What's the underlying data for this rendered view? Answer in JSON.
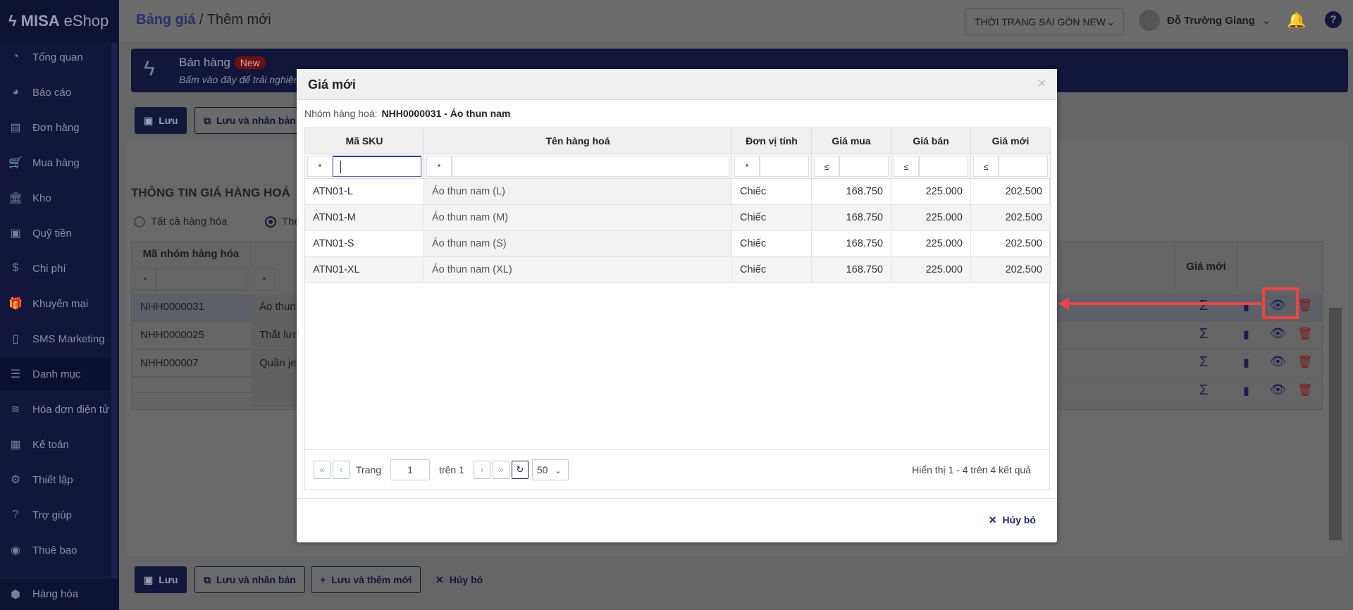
{
  "app": {
    "logo": "MISA",
    "logo_suffix": "eShop"
  },
  "sidebar": {
    "items": [
      {
        "label": "Tổng quan",
        "icon": "dashboard-icon",
        "glyph": "◔"
      },
      {
        "label": "Báo cáo",
        "icon": "pie-chart-icon",
        "glyph": "◕"
      },
      {
        "label": "Đơn hàng",
        "icon": "order-icon",
        "glyph": "▤"
      },
      {
        "label": "Mua hàng",
        "icon": "cart-icon",
        "glyph": "🛒"
      },
      {
        "label": "Kho",
        "icon": "warehouse-icon",
        "glyph": "🏛"
      },
      {
        "label": "Quỹ tiền",
        "icon": "safe-icon",
        "glyph": "▣"
      },
      {
        "label": "Chi phí",
        "icon": "money-bag-icon",
        "glyph": "$"
      },
      {
        "label": "Khuyến mại",
        "icon": "gift-icon",
        "glyph": "🎁"
      },
      {
        "label": "SMS Marketing",
        "icon": "phone-icon",
        "glyph": "▯"
      },
      {
        "label": "Danh mục",
        "icon": "list-icon",
        "glyph": "☰"
      },
      {
        "label": "Hóa đơn điện tử",
        "icon": "invoice-icon",
        "glyph": "≋"
      },
      {
        "label": "Kế toán",
        "icon": "calculator-icon",
        "glyph": "▦"
      },
      {
        "label": "Thiết lập",
        "icon": "gear-icon",
        "glyph": "⚙"
      },
      {
        "label": "Trợ giúp",
        "icon": "help-icon",
        "glyph": "?"
      },
      {
        "label": "Thuê bao",
        "icon": "user-circle-icon",
        "glyph": "◉"
      }
    ],
    "bottom": {
      "label": "Hàng hóa",
      "glyph": "⬢"
    }
  },
  "header": {
    "breadcrumb_parent": "Bảng giá",
    "breadcrumb_sep": " / ",
    "breadcrumb_current": "Thêm mới",
    "store": "THỜI TRANG SÀI GÒN NEW",
    "user": "Đỗ Trường Giang"
  },
  "banner": {
    "title": "Bán hàng",
    "badge": "New",
    "subtitle": "Bấm vào đây để trải nghiệm"
  },
  "toolbar": {
    "save": "Lưu",
    "save_copy": "Lưu và nhân bản",
    "save_new": "Lưu và thêm mới",
    "cancel": "Hủy bỏ"
  },
  "page": {
    "section_title": "THÔNG TIN GIÁ HÀNG HOÁ",
    "radio_all": "Tất cả hàng hóa",
    "radio_other": "The",
    "table": {
      "col_code": "Mã nhóm hàng hóa",
      "col_price": "Giá mới",
      "filter_op": "*",
      "rows": [
        {
          "code": "NHH0000031",
          "name": "Áo thun"
        },
        {
          "code": "NHH0000025",
          "name": "Thắt lưn"
        },
        {
          "code": "NHH000007",
          "name": "Quần jea"
        },
        {
          "code": "",
          "name": ""
        }
      ]
    }
  },
  "modal": {
    "title": "Giá mới",
    "close": "×",
    "group_label": "Nhóm hàng hoá:",
    "group_value": "NHH0000031 - Áo thun nam",
    "columns": [
      "Mã SKU",
      "Tên hàng hoá",
      "Đơn vị tính",
      "Giá mua",
      "Giá bán",
      "Giá mới"
    ],
    "filter_ops": [
      "*",
      "*",
      "*",
      "≤",
      "≤",
      "≤"
    ],
    "rows": [
      [
        "ATN01-L",
        "Áo thun nam (L)",
        "Chiếc",
        "168.750",
        "225.000",
        "202.500"
      ],
      [
        "ATN01-M",
        "Áo thun nam (M)",
        "Chiếc",
        "168.750",
        "225.000",
        "202.500"
      ],
      [
        "ATN01-S",
        "Áo thun nam (S)",
        "Chiếc",
        "168.750",
        "225.000",
        "202.500"
      ],
      [
        "ATN01-XL",
        "Áo thun nam (XL)",
        "Chiếc",
        "168.750",
        "225.000",
        "202.500"
      ]
    ],
    "pager": {
      "first": "«",
      "prev": "‹",
      "page_label": "Trang",
      "page": "1",
      "of": "trên 1",
      "next": "›",
      "last": "»",
      "refresh": "↻",
      "size": "50",
      "info": "Hiển thị 1 - 4 trên 4 kết quả"
    },
    "cancel": "Hủy bỏ"
  },
  "colors": {
    "primary": "#1e2566",
    "annotation": "#f04444",
    "danger": "#c41e1e"
  }
}
